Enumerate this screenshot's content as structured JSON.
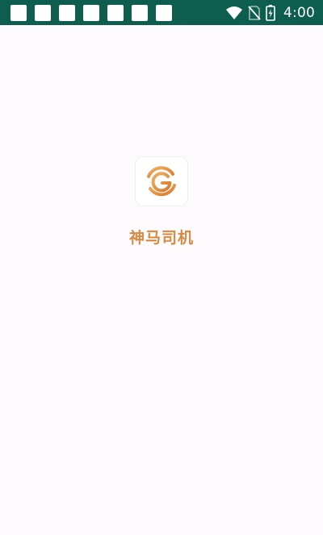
{
  "status_bar": {
    "background": "#0d5e4f",
    "notification_icons": [
      "notification-icon",
      "notification-icon",
      "notification-icon",
      "notification-icon",
      "notification-icon",
      "notification-icon",
      "notification-icon"
    ],
    "system_icons": [
      "wifi-icon",
      "no-sim-icon",
      "battery-charging-icon"
    ],
    "time": "4:00"
  },
  "splash": {
    "app_icon": "app-logo-icon",
    "app_name": "神马司机",
    "accent_color": "#d98a40"
  }
}
